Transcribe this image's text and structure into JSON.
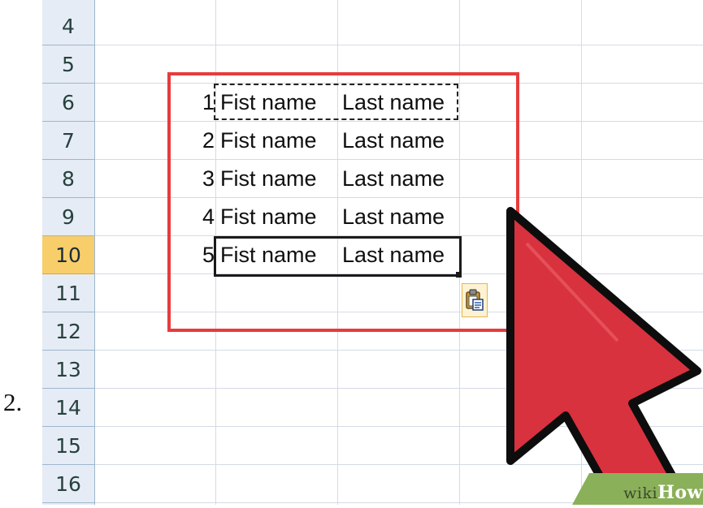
{
  "step_number": "2.",
  "rows": [
    {
      "header": "4",
      "active": false,
      "num": "",
      "first": "",
      "last": ""
    },
    {
      "header": "5",
      "active": false,
      "num": "",
      "first": "",
      "last": ""
    },
    {
      "header": "6",
      "active": false,
      "num": "1",
      "first": "Fist name",
      "last": "Last name"
    },
    {
      "header": "7",
      "active": false,
      "num": "2",
      "first": "Fist name",
      "last": "Last name"
    },
    {
      "header": "8",
      "active": false,
      "num": "3",
      "first": "Fist name",
      "last": "Last name"
    },
    {
      "header": "9",
      "active": false,
      "num": "4",
      "first": "Fist name",
      "last": "Last name"
    },
    {
      "header": "10",
      "active": true,
      "num": "5",
      "first": "Fist name",
      "last": "Last name"
    },
    {
      "header": "11",
      "active": false,
      "num": "",
      "first": "",
      "last": ""
    },
    {
      "header": "12",
      "active": false,
      "num": "",
      "first": "",
      "last": ""
    },
    {
      "header": "13",
      "active": false,
      "num": "",
      "first": "",
      "last": ""
    },
    {
      "header": "14",
      "active": false,
      "num": "",
      "first": "",
      "last": ""
    },
    {
      "header": "15",
      "active": false,
      "num": "",
      "first": "",
      "last": ""
    },
    {
      "header": "16",
      "active": false,
      "num": "",
      "first": "",
      "last": ""
    }
  ],
  "paste_options_icon": "clipboard-paste-icon",
  "cursor_icon": "mouse-pointer-arrow-icon",
  "watermark": {
    "wiki": "wiki",
    "how": "How"
  },
  "colors": {
    "highlight_box": "#e63c3c",
    "cursor_fill": "#d8323f",
    "active_row_header": "#f7ce6a",
    "row_header_bg": "#e6ecf5",
    "watermark_green": "#8bb05a"
  }
}
